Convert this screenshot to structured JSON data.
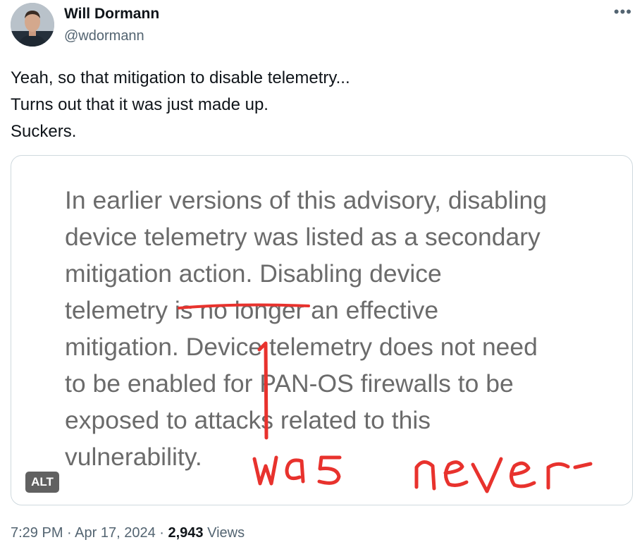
{
  "author": {
    "name": "Will Dormann",
    "handle": "@wdormann"
  },
  "more_icon": "more-horizontal-icon",
  "tweet": {
    "lines": [
      "Yeah, so that mitigation to disable telemetry...",
      "Turns out that it was just made up.",
      "Suckers."
    ]
  },
  "media": {
    "advisory_lines": [
      "In earlier versions of this advisory, disabling",
      "device telemetry was listed as a secondary",
      "mitigation action. Disabling device",
      "telemetry is no longer an effective",
      "mitigation. Device telemetry does not need",
      "to be enabled for PAN-OS firewalls to be",
      "exposed to attacks related to this",
      "vulnerability."
    ],
    "handwritten_note": "was never",
    "alt_label": "ALT",
    "scribble_color": "#e8322d"
  },
  "meta": {
    "time": "7:29 PM",
    "separator": "·",
    "date": "Apr 17, 2024",
    "views_count": "2,943",
    "views_label": "Views"
  }
}
